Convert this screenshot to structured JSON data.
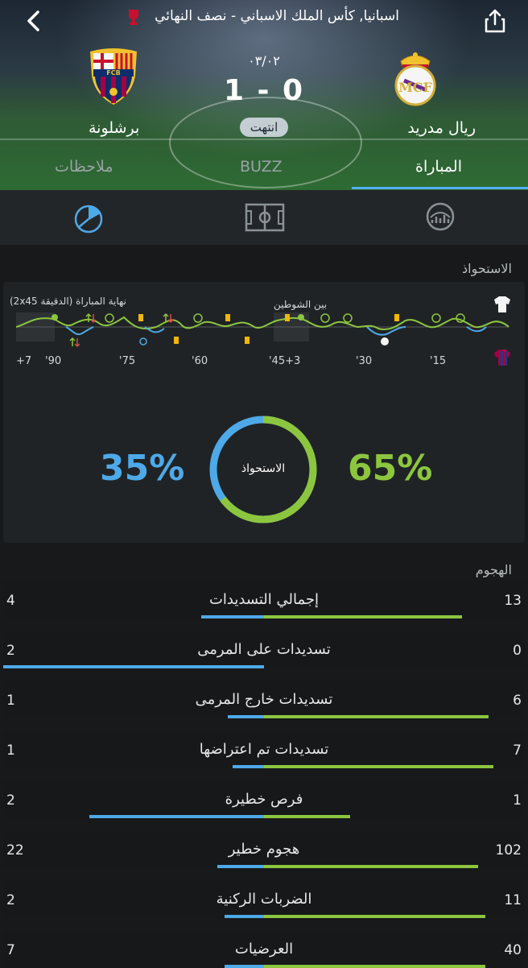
{
  "header": {
    "competition": "اسبانيا, كأس الملك الاسباني - نصف النهائي",
    "date": "٠٣/٠٢",
    "score": "1 - 0",
    "status": "انتهت",
    "home_team": "ريال مدريد",
    "away_team": "برشلونة",
    "icons": {
      "back": "back-chevron-icon",
      "share": "share-icon",
      "cup": "cup-icon"
    }
  },
  "tabs": [
    {
      "label": "المباراة",
      "active": true
    },
    {
      "label": "BUZZ",
      "active": false
    },
    {
      "label": "ملاحظات",
      "active": false
    }
  ],
  "subnav": {
    "icons": [
      "stats-gauge-icon",
      "pitch-icon",
      "possession-pie-icon"
    ]
  },
  "possession": {
    "section_title": "الاستحواذ",
    "timeline_labels": {
      "fulltime": "(2x45 الدقيقة) نهاية المباراة",
      "halftime": "بين الشوطين",
      "ticks": [
        "+7",
        "'90",
        "'75",
        "'60",
        "'45+3",
        "'30",
        "'15"
      ]
    },
    "home_pct": "65%",
    "away_pct": "35%",
    "donut_label": "الاستحواذ",
    "home_share": 0.65,
    "colors": {
      "home": "#8cc63f",
      "away": "#4ea9e8"
    }
  },
  "attack": {
    "section_title": "الهجوم",
    "rows": [
      {
        "label": "إجمالي التسديدات",
        "home": "13",
        "away": "4",
        "home_frac": 0.76,
        "away_frac": 0.24
      },
      {
        "label": "تسديدات على المرمى",
        "home": "0",
        "away": "2",
        "home_frac": 0.0,
        "away_frac": 1.0
      },
      {
        "label": "تسديدات خارج المرمى",
        "home": "6",
        "away": "1",
        "home_frac": 0.86,
        "away_frac": 0.14
      },
      {
        "label": "تسديدات تم اعتراضها",
        "home": "7",
        "away": "1",
        "home_frac": 0.88,
        "away_frac": 0.12
      },
      {
        "label": "فرص خطيرة",
        "home": "1",
        "away": "2",
        "home_frac": 0.33,
        "away_frac": 0.67
      },
      {
        "label": "هجوم خطير",
        "home": "102",
        "away": "22",
        "home_frac": 0.82,
        "away_frac": 0.18
      },
      {
        "label": "الضربات الركنية",
        "home": "11",
        "away": "2",
        "home_frac": 0.85,
        "away_frac": 0.15
      },
      {
        "label": "العرضيات",
        "home": "40",
        "away": "7",
        "home_frac": 0.85,
        "away_frac": 0.15
      }
    ]
  }
}
